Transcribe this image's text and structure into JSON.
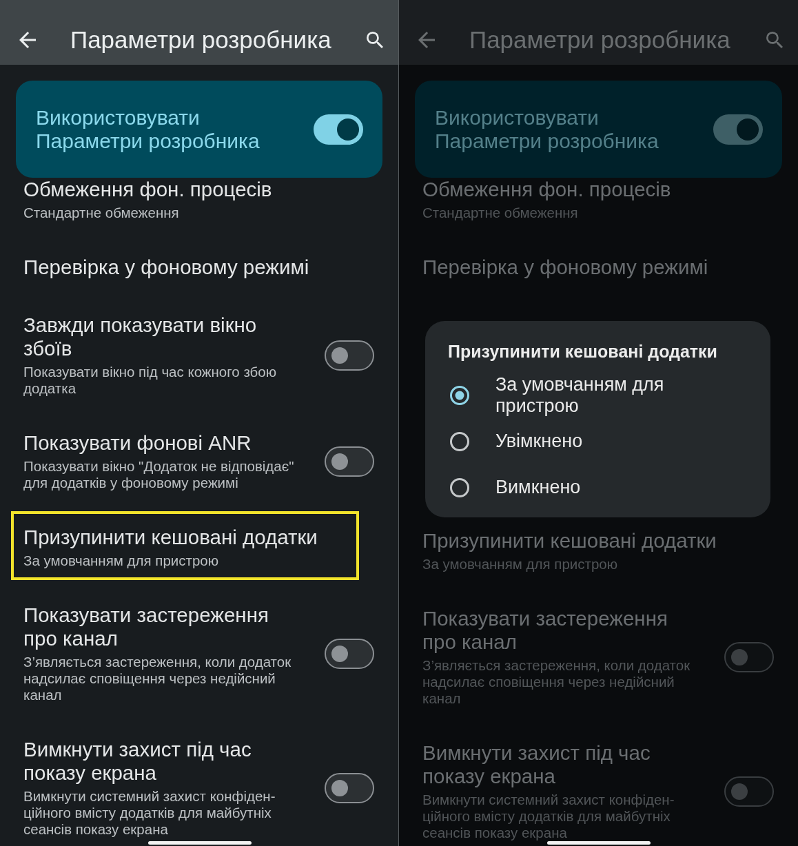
{
  "panels": [
    {
      "dimmed": false,
      "app_bar": {
        "title": "Параметри розробника"
      },
      "master_switch": {
        "label": "Використовувати Параметри розробника",
        "on": true
      },
      "items": [
        {
          "kind": "text",
          "title": "Обмеження фон. процесів",
          "summary": "Стандартне обмеження",
          "highlighted": false
        },
        {
          "kind": "text",
          "title": "Перевірка у фоновому режимі",
          "highlighted": false
        },
        {
          "kind": "switch",
          "title": "Завжди показувати вікно збоїв",
          "summary": "Показувати вікно під час кожного збою додатка",
          "on": false,
          "highlighted": false
        },
        {
          "kind": "switch",
          "title": "Показувати фонові ANR",
          "summary": "Показувати вікно \"Додаток не відповідає\" для додатків у фоновому режимі",
          "on": false,
          "highlighted": false
        },
        {
          "kind": "text",
          "title": "Призупинити кешовані додатки",
          "summary": "За умовчанням для пристрою",
          "highlighted": true
        },
        {
          "kind": "switch",
          "title": "Показувати застереження про канал",
          "summary": "З’являється застереження, коли додаток надсилає сповіщення через недійсний канал",
          "on": false,
          "highlighted": false
        },
        {
          "kind": "switch",
          "title": "Вимкнути захист під час показу екрана",
          "summary": "Вимкнути системний захист конфіден-ційного вмісту додатків для майбутніх сеансів показу екрана",
          "on": false,
          "highlighted": false
        }
      ]
    },
    {
      "dimmed": true,
      "app_bar": {
        "title": "Параметри розробника"
      },
      "master_switch": {
        "label": "Використовувати Параметри розробника",
        "on": true
      },
      "items": [
        {
          "kind": "text",
          "title": "Обмеження фон. процесів",
          "summary": "Стандартне обмеження",
          "highlighted": false
        },
        {
          "kind": "text",
          "title": "Перевірка у фоновому режимі",
          "highlighted": false
        }
      ],
      "dialog": {
        "title": "Призупинити кешовані додатки",
        "options": [
          {
            "label": "За умовчанням для пристрою",
            "selected": true
          },
          {
            "label": "Увімкнено",
            "selected": false
          },
          {
            "label": "Вимкнено",
            "selected": false
          }
        ]
      },
      "items_below": [
        {
          "kind": "text",
          "title": "Призупинити кешовані додатки",
          "summary": "За умовчанням для пристрою",
          "highlighted": false
        },
        {
          "kind": "switch",
          "title": "Показувати застереження про канал",
          "summary": "З’являється застереження, коли додаток надсилає сповіщення через недійсний канал",
          "on": false,
          "highlighted": false
        },
        {
          "kind": "switch",
          "title": "Вимкнути захист під час показу екрана",
          "summary": "Вимкнути системний захист конфіден-ційного вмісту додатків для майбутніх сеансів показу екрана",
          "on": false,
          "highlighted": false
        }
      ]
    }
  ]
}
